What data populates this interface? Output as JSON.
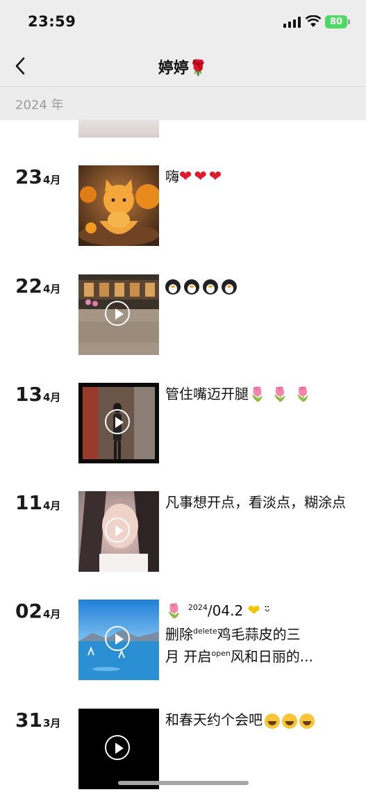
{
  "status_bar": {
    "time": "23:59",
    "battery": "80"
  },
  "nav": {
    "title": "婷婷",
    "title_emoji": "🌹"
  },
  "year_header": "2024 年",
  "posts": [
    {
      "day": "23",
      "month": "4月",
      "text": "嗨",
      "emojis": [
        "red-heart",
        "red-heart",
        "red-heart"
      ],
      "media": "image"
    },
    {
      "day": "22",
      "month": "4月",
      "text": "",
      "emojis": [
        "penguin",
        "penguin",
        "penguin",
        "penguin"
      ],
      "media": "video"
    },
    {
      "day": "13",
      "month": "4月",
      "text": "管住嘴迈开腿",
      "emojis": [
        "tulip",
        "tulip",
        "tulip"
      ],
      "media": "video"
    },
    {
      "day": "11",
      "month": "4月",
      "text": "凡事想开点，看淡点，糊涂点",
      "media": "video"
    },
    {
      "day": "02",
      "month": "4月",
      "text_line1_date_a": "2024",
      "text_line1_date_b": "/04.2",
      "text_line2_a": "删除",
      "text_line2_sup": "delete",
      "text_line2_b": "鸡毛蒜皮的三",
      "text_line3_a": "月 开启",
      "text_line3_sup": "open",
      "text_line3_b": "风和日丽的...",
      "media": "video"
    },
    {
      "day": "31",
      "month": "3月",
      "text": "和春天约个会吧",
      "emojis": [
        "laughing",
        "laughing",
        "laughing"
      ],
      "media": "video"
    }
  ]
}
